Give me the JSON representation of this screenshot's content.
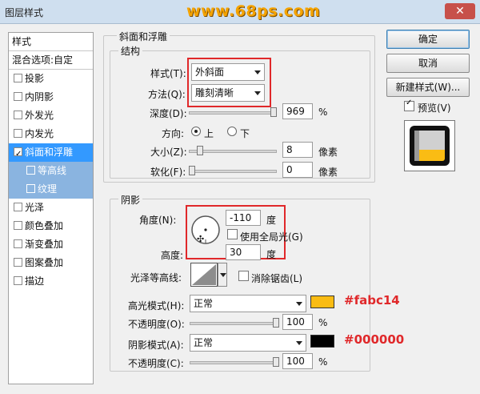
{
  "window": {
    "title": "图层样式",
    "watermark": "www.68ps.com",
    "close_glyph": "✕"
  },
  "sidebar": {
    "header": "样式",
    "blend": "混合选项:自定",
    "items": [
      {
        "label": "投影",
        "checked": false
      },
      {
        "label": "内阴影",
        "checked": false
      },
      {
        "label": "外发光",
        "checked": false
      },
      {
        "label": "内发光",
        "checked": false
      },
      {
        "label": "斜面和浮雕",
        "checked": true,
        "selected": true
      },
      {
        "label": "等高线",
        "checked": false,
        "sub": true
      },
      {
        "label": "纹理",
        "checked": false,
        "sub": true
      },
      {
        "label": "光泽",
        "checked": false
      },
      {
        "label": "颜色叠加",
        "checked": false
      },
      {
        "label": "渐变叠加",
        "checked": false
      },
      {
        "label": "图案叠加",
        "checked": false
      },
      {
        "label": "描边",
        "checked": false
      }
    ]
  },
  "bevel": {
    "section_title": "斜面和浮雕",
    "structure_title": "结构",
    "style_label": "样式(T):",
    "style_value": "外斜面",
    "technique_label": "方法(Q):",
    "technique_value": "雕刻清晰",
    "depth_label": "深度(D):",
    "depth_value": "969",
    "depth_unit": "%",
    "direction_label": "方向:",
    "direction_up": "上",
    "direction_down": "下",
    "size_label": "大小(Z):",
    "size_value": "8",
    "size_unit": "像素",
    "soften_label": "软化(F):",
    "soften_value": "0",
    "soften_unit": "像素"
  },
  "shading": {
    "title": "阴影",
    "angle_label": "角度(N):",
    "angle_value": "-110",
    "angle_unit": "度",
    "global_light_label": "使用全局光(G)",
    "altitude_label": "高度:",
    "altitude_value": "30",
    "altitude_unit": "度",
    "gloss_label": "光泽等高线:",
    "antialias_label": "消除锯齿(L)",
    "highlight_label": "高光模式(H):",
    "highlight_mode": "正常",
    "highlight_color": "#fabc14",
    "highlight_hex": "#fabc14",
    "highlight_opacity_label": "不透明度(O):",
    "highlight_opacity": "100",
    "highlight_opacity_unit": "%",
    "shadow_label": "阴影模式(A):",
    "shadow_mode": "正常",
    "shadow_color": "#000000",
    "shadow_hex": "#000000",
    "shadow_opacity_label": "不透明度(C):",
    "shadow_opacity": "100",
    "shadow_opacity_unit": "%"
  },
  "buttons": {
    "ok": "确定",
    "cancel": "取消",
    "new_style": "新建样式(W)...",
    "preview": "预览(V)"
  }
}
